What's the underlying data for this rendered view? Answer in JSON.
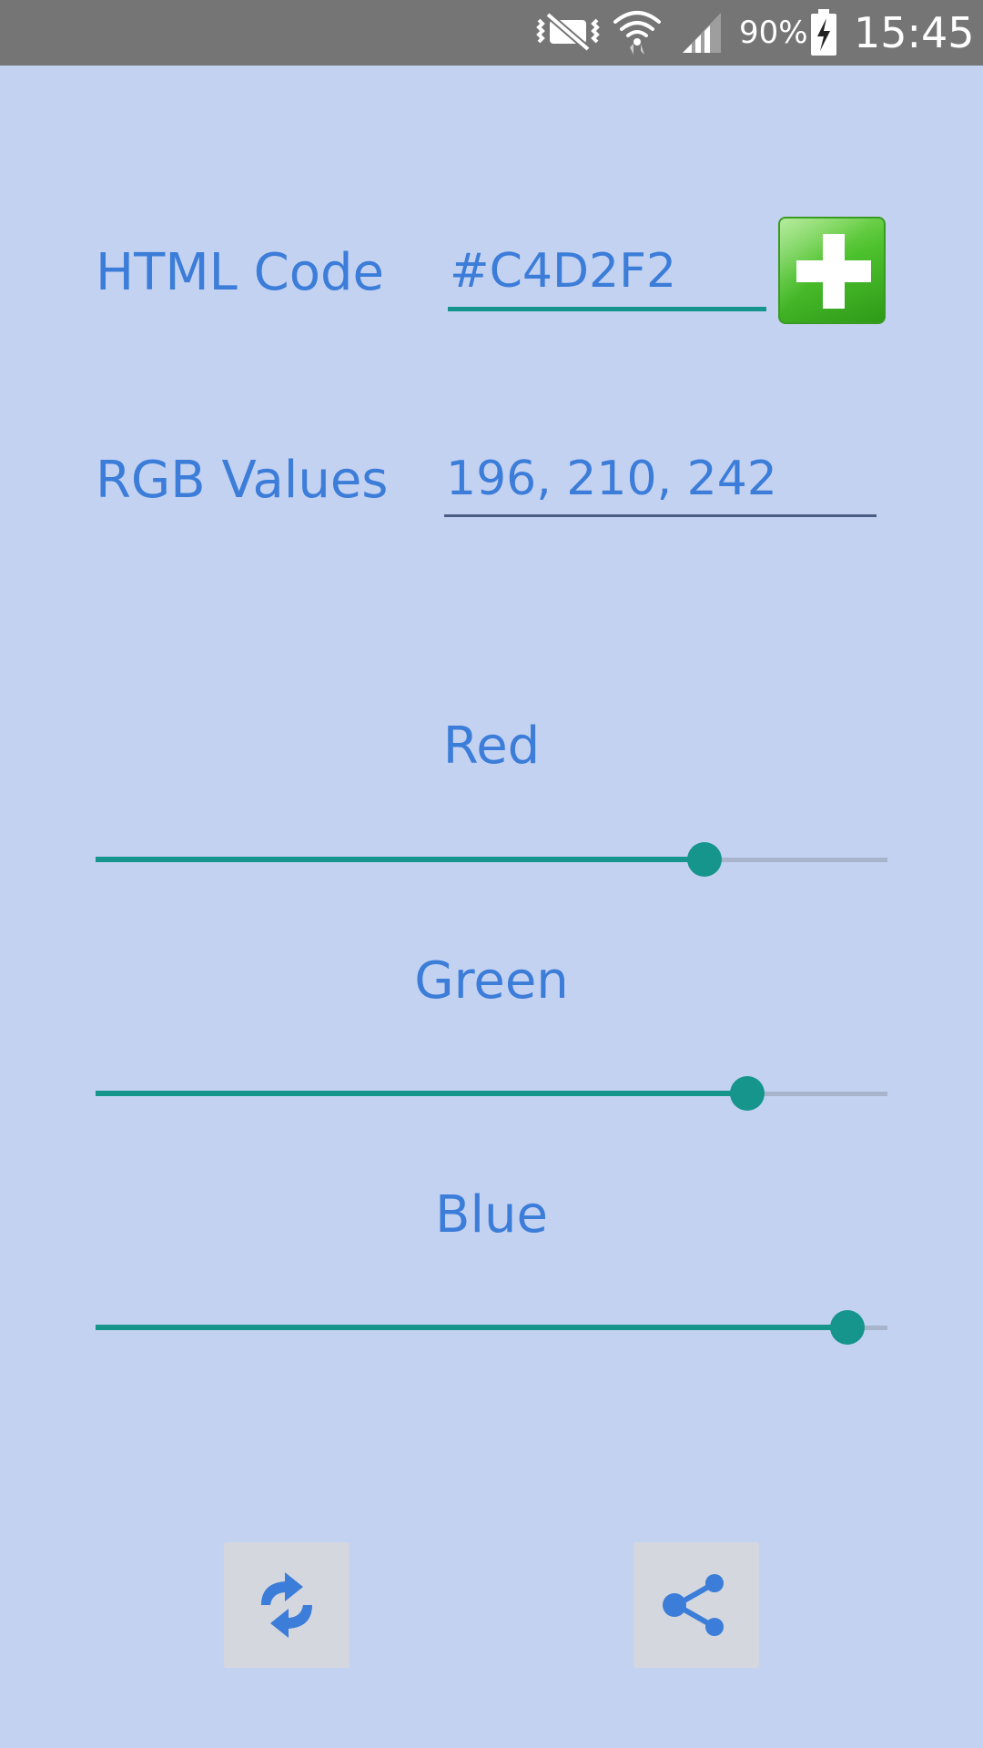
{
  "status_bar": {
    "battery_percent": "90%",
    "time": "15:45",
    "icons": [
      "mute-icon",
      "wifi-icon",
      "signal-icon",
      "battery-charging-icon"
    ]
  },
  "form": {
    "html_code_label": "HTML Code",
    "html_code_value": "#C4D2F2",
    "rgb_label": "RGB Values",
    "rgb_value": "196, 210, 242",
    "add_icon": "plus-icon"
  },
  "sliders": {
    "red": {
      "label": "Red",
      "value": 196,
      "max": 255
    },
    "green": {
      "label": "Green",
      "value": 210,
      "max": 255
    },
    "blue": {
      "label": "Blue",
      "value": 242,
      "max": 255
    }
  },
  "actions": {
    "refresh_icon": "refresh-icon",
    "share_icon": "share-icon"
  },
  "colors": {
    "background": "#C4D2F2",
    "accent": "#15958B",
    "text": "#3B7DD8",
    "status_bar": "#757575",
    "add_button": "#4DC12D"
  }
}
